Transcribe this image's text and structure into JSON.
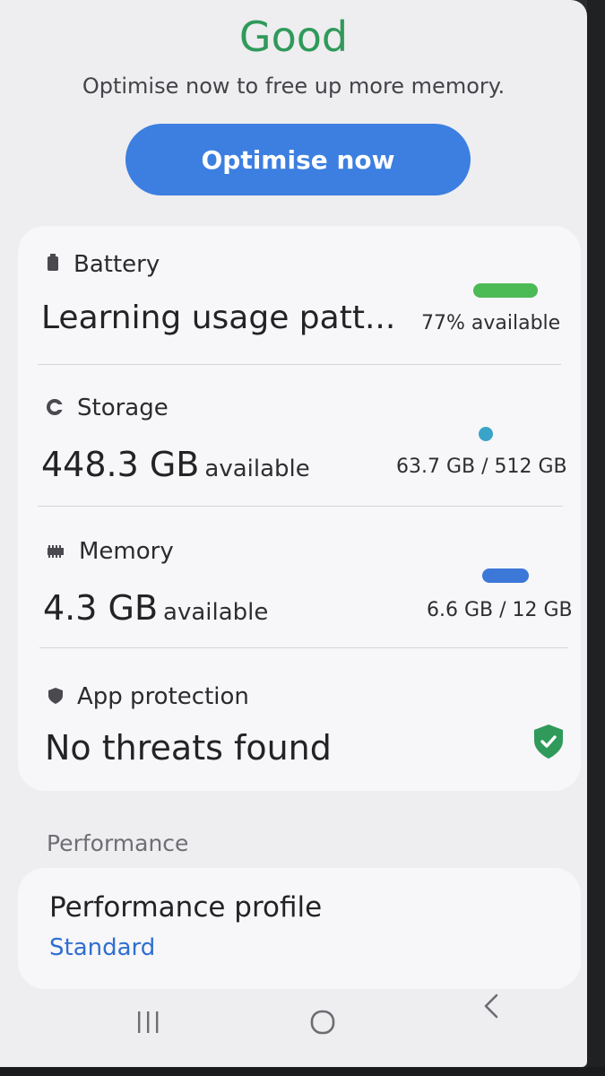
{
  "status": {
    "title": "Good",
    "subtitle": "Optimise now to free up more memory.",
    "optimise_label": "Optimise now"
  },
  "battery": {
    "label": "Battery",
    "icon": "battery-icon",
    "value_text": "Learning usage patt...",
    "right_text": "77% available",
    "level_percent": 77,
    "bar_color": "#4cba55"
  },
  "storage": {
    "label": "Storage",
    "icon": "storage-icon",
    "value_big": "448.3 GB",
    "value_unit": "available",
    "right_text": "63.7 GB / 512 GB",
    "used_percent": 12.4,
    "bar_color": "#3aa4c8"
  },
  "memory": {
    "label": "Memory",
    "icon": "memory-chip-icon",
    "value_big": "4.3 GB",
    "value_unit": "available",
    "right_text": "6.6 GB / 12 GB",
    "used_percent": 55,
    "bar_color": "#3c78d8"
  },
  "app_protection": {
    "label": "App protection",
    "icon": "shield-icon",
    "value_text": "No threats found",
    "status_icon": "shield-check-icon",
    "status_color": "#2f9a5a"
  },
  "performance": {
    "header": "Performance",
    "title": "Performance profile",
    "value": "Standard"
  },
  "navbar": {
    "recents_icon": "recents-icon",
    "home_icon": "home-icon",
    "back_icon": "back-icon"
  }
}
